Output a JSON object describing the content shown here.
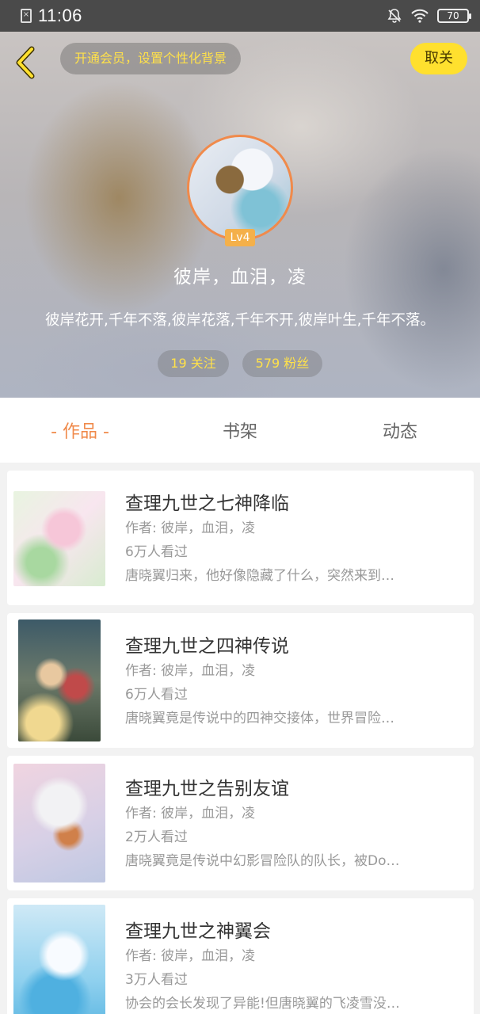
{
  "status": {
    "time": "11:06",
    "battery": "70"
  },
  "header": {
    "vip_label": "开通会员，设置个性化背景",
    "unfollow_label": "取关"
  },
  "profile": {
    "level": "Lv4",
    "username": "彼岸，血泪，凌",
    "bio": "彼岸花开,千年不落,彼岸花落,千年不开,彼岸叶生,千年不落。",
    "following": "19 关注",
    "followers": "579 粉丝"
  },
  "tabs": [
    {
      "label": "- 作品 -",
      "active": true
    },
    {
      "label": "书架",
      "active": false
    },
    {
      "label": "动态",
      "active": false
    }
  ],
  "works": [
    {
      "title": "查理九世之七神降临",
      "author": "作者: 彼岸，血泪，凌",
      "views": "6万人看过",
      "desc": "唐晓翼归来，他好像隐藏了什么，突然来到…"
    },
    {
      "title": "查理九世之四神传说",
      "author": "作者: 彼岸，血泪，凌",
      "views": "6万人看过",
      "desc": "唐晓翼竟是传说中的四神交接体，世界冒险…"
    },
    {
      "title": "查理九世之告别友谊",
      "author": "作者: 彼岸，血泪，凌",
      "views": "2万人看过",
      "desc": "唐晓翼竟是传说中幻影冒险队的队长，被Do…"
    },
    {
      "title": "查理九世之神翼会",
      "author": "作者: 彼岸，血泪，凌",
      "views": "3万人看过",
      "desc": "协会的会长发现了异能!但唐晓翼的飞凌雪没…"
    }
  ],
  "colors": {
    "accent": "#f08a4b",
    "vip_text": "#ffe14a",
    "unfollow_bg": "#ffe02e"
  }
}
